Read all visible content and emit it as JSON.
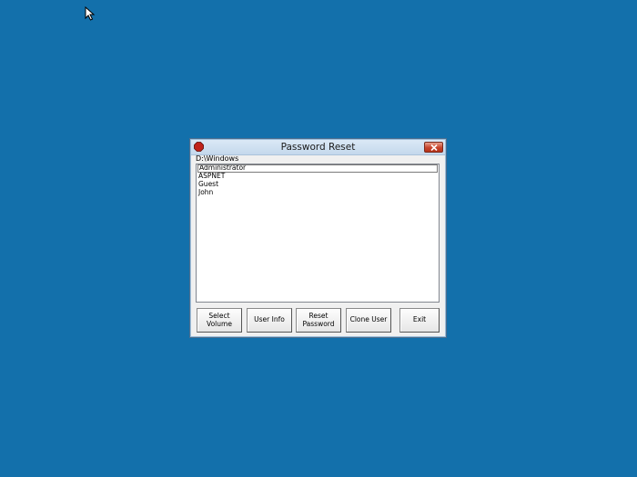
{
  "window": {
    "title": "Password Reset",
    "close_icon": "close-icon",
    "app_icon": "red-octagon-icon"
  },
  "path_label": "D:\\Windows",
  "users": [
    "Administrator",
    "ASPNET",
    "Guest",
    "John"
  ],
  "buttons": {
    "select_volume": "Select\nVolume",
    "user_info": "User Info",
    "reset_password": "Reset\nPassword",
    "clone_user": "Clone User",
    "exit": "Exit"
  },
  "colors": {
    "desktop": "#1370ab",
    "close_button": "#c7432c",
    "window_bg": "#f0f0f0"
  }
}
